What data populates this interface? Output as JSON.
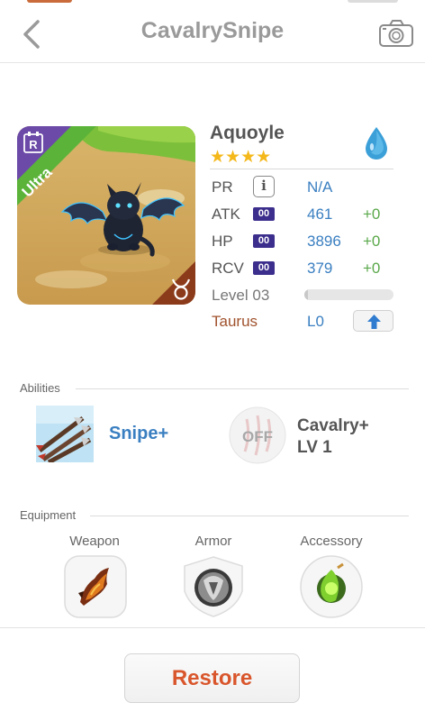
{
  "nav": {
    "title": "CavalrySnipe"
  },
  "monster": {
    "rarity": "Ultra",
    "name": "Aquoyle",
    "stars": "★★★★",
    "element_icon": "water-drop-icon",
    "zodiac_icon": "taurus-icon"
  },
  "stats": {
    "pr": {
      "label": "PR",
      "value": "N/A"
    },
    "atk": {
      "label": "ATK",
      "badge": "00",
      "value": "461",
      "plus": "+0"
    },
    "hp": {
      "label": "HP",
      "badge": "00",
      "value": "3896",
      "plus": "+0"
    },
    "rcv": {
      "label": "RCV",
      "badge": "00",
      "value": "379",
      "plus": "+0"
    },
    "level": {
      "label": "Level 03",
      "progress": 0.04
    },
    "zodiac": {
      "label": "Taurus",
      "value": "L0"
    }
  },
  "abilities": {
    "section_label": "Abilities",
    "items": [
      {
        "name": "Snipe+"
      },
      {
        "status": "OFF",
        "name_line1": "Cavalry+",
        "name_line2": "LV 1"
      }
    ]
  },
  "equipment": {
    "section_label": "Equipment",
    "slots": [
      {
        "label": "Weapon"
      },
      {
        "label": "Armor"
      },
      {
        "label": "Accessory"
      }
    ]
  },
  "footer": {
    "restore_label": "Restore"
  },
  "colors": {
    "accent_blue": "#3a7fc1",
    "green_plus": "#5aa84a",
    "taurus_brown": "#a0522d",
    "restore_orange": "#d9562c",
    "star_gold": "#f4b81a",
    "ultra_green": "#5bb33a",
    "badge_purple": "#3b2e8c"
  }
}
